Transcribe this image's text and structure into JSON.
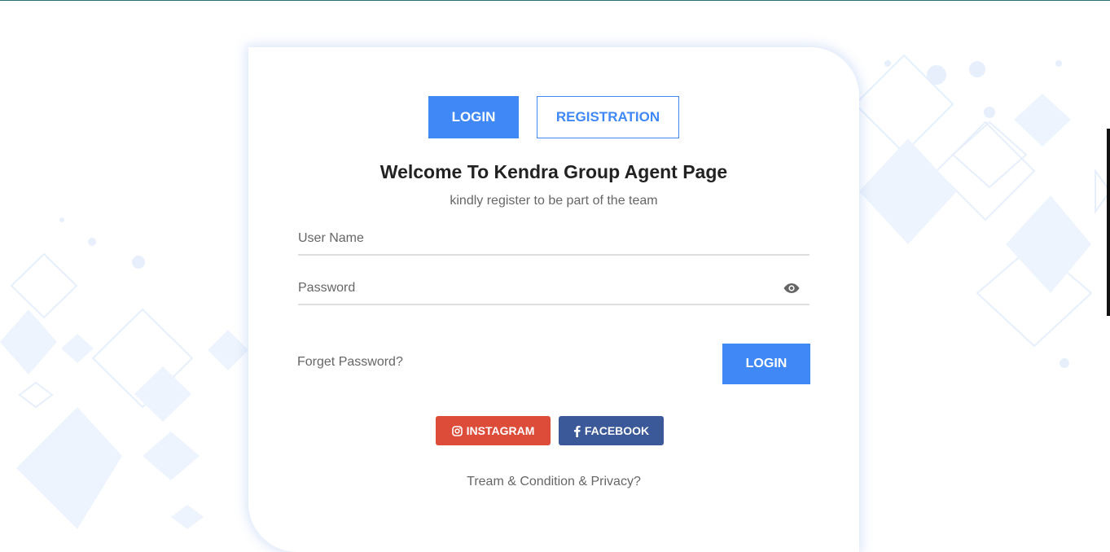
{
  "tabs": {
    "login_label": "LOGIN",
    "registration_label": "REGISTRATION",
    "active": "login"
  },
  "header": {
    "title": "Welcome To Kendra Group Agent Page",
    "subtitle": "kindly register to be part of the team"
  },
  "form": {
    "username": {
      "placeholder": "User Name",
      "value": ""
    },
    "password": {
      "placeholder": "Password",
      "value": ""
    },
    "forget_label": "Forget Password?",
    "login_button": "LOGIN"
  },
  "social": {
    "instagram_label": "INSTAGRAM",
    "facebook_label": "FACEBOOK"
  },
  "footer": {
    "terms_label": "Tream & Condition & Privacy?"
  },
  "colors": {
    "primary": "#3f88f5",
    "instagram": "#dd4b39",
    "facebook": "#3b5998",
    "text_dark": "#222222",
    "text_muted": "#666666"
  },
  "icons": {
    "password_toggle": "eye-icon",
    "instagram": "instagram-icon",
    "facebook": "facebook-icon"
  }
}
